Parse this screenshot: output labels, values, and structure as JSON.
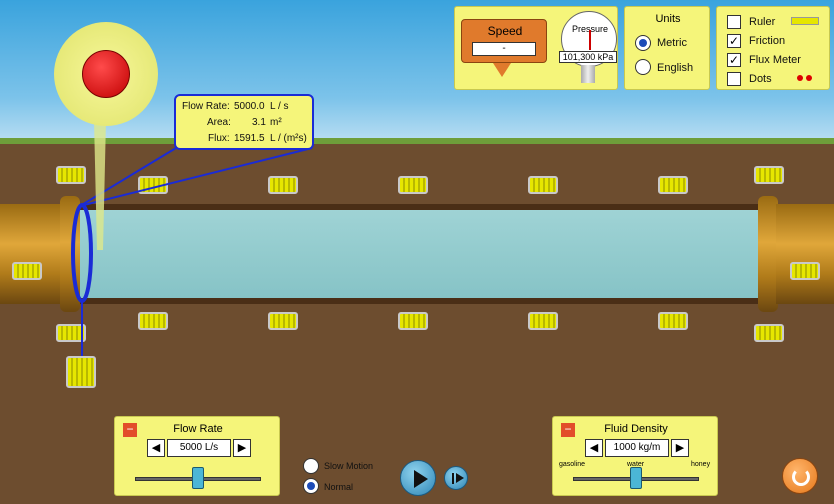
{
  "speed": {
    "title": "Speed",
    "value": "-"
  },
  "pressure": {
    "title": "Pressure",
    "value": "101,300 kPa"
  },
  "units": {
    "title": "Units",
    "options": [
      "Metric",
      "English"
    ],
    "selected": "Metric"
  },
  "options": {
    "ruler": {
      "label": "Ruler",
      "checked": false
    },
    "friction": {
      "label": "Friction",
      "checked": true
    },
    "flux_meter": {
      "label": "Flux Meter",
      "checked": true
    },
    "dots": {
      "label": "Dots",
      "checked": false
    }
  },
  "flux_readout": {
    "flow_rate_label": "Flow Rate:",
    "flow_rate_value": "5000.0",
    "flow_rate_unit": "L / s",
    "area_label": "Area:",
    "area_value": "3.1",
    "area_unit": "m²",
    "flux_label": "Flux:",
    "flux_value": "1591.5",
    "flux_unit": "L / (m²s)"
  },
  "flow_rate_panel": {
    "title": "Flow Rate",
    "value": "5000 L/s",
    "collapse": "−",
    "level_fraction": 0.5
  },
  "density_panel": {
    "title": "Fluid Density",
    "value": "1000 kg/m",
    "collapse": "−",
    "ticks": [
      "gasoline",
      "water",
      "honey"
    ],
    "level_fraction": 0.5
  },
  "playback": {
    "slow_label": "Slow Motion",
    "normal_label": "Normal",
    "selected": "Normal"
  },
  "colors": {
    "panel": "#f5f57a",
    "accent": "#1c4bb8",
    "speed_box": "#e07a2c"
  }
}
